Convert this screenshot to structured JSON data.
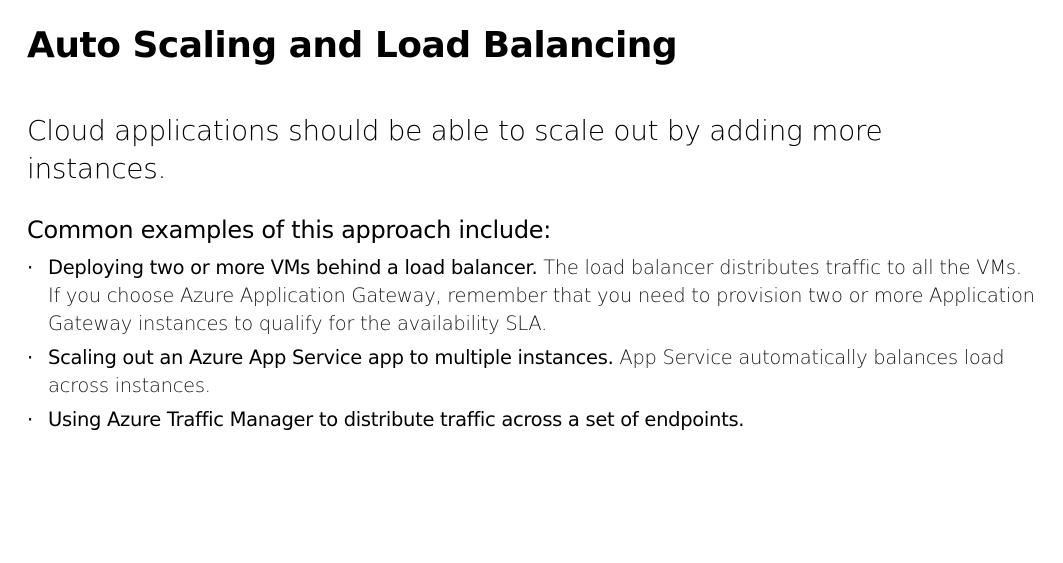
{
  "slide": {
    "title": "Auto Scaling and Load Balancing",
    "intro": "Cloud applications should be able to scale out by adding more instances.",
    "examples_heading": "Common examples of this approach include:",
    "bullet_marker": "·",
    "bullets": [
      {
        "lead": "Deploying two or more VMs behind a load balancer.",
        "detail": " The load balancer distributes traffic to all the VMs. If you choose Azure Application Gateway, remember that you need to provision two or more Application Gateway instances to qualify for the availability SLA."
      },
      {
        "lead": "Scaling out an Azure App Service app to multiple instances.",
        "detail": " App Service automatically balances load across instances."
      },
      {
        "lead": "Using Azure Traffic Manager to distribute traffic across a set of endpoints.",
        "detail": ""
      }
    ]
  }
}
